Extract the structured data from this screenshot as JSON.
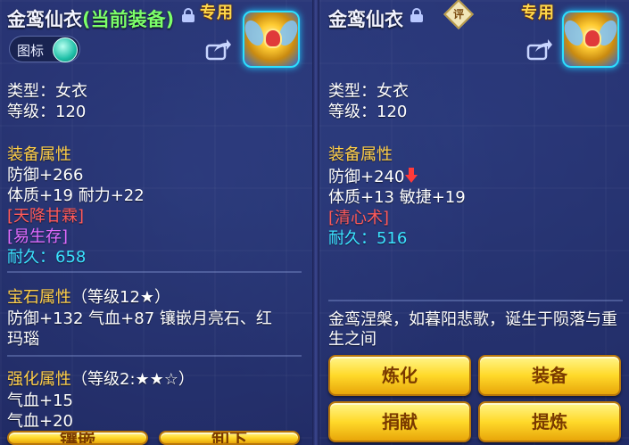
{
  "left": {
    "title": "金鸾仙衣",
    "equip_state": "(当前装备)",
    "exclusive": "专用",
    "icon_toggle_label": "图标",
    "info": [
      "类型：女衣",
      "等级：120"
    ],
    "attr_title": "装备属性",
    "attrs": [
      "防御+266",
      "体质+19 耐力+22"
    ],
    "special_1": "[天降甘霖]",
    "special_2": "[易生存]",
    "durability_label": "耐久：",
    "durability_value": "658",
    "gem_title": "宝石属性",
    "gem_level": "（等级12★）",
    "gem_line_1": "防御+132 气血+87 镶嵌月亮石、红",
    "gem_line_2": "玛瑙",
    "enhance_title": "强化属性",
    "enhance_level": "（等级2:★★☆）",
    "enhance_lines": [
      "气血+15",
      "气血+20"
    ],
    "buttons": [
      "镶嵌",
      "卸下"
    ]
  },
  "right": {
    "title": "金鸾仙衣",
    "rate_badge": "评",
    "exclusive": "专用",
    "info": [
      "类型：女衣",
      "等级：120"
    ],
    "attr_title": "装备属性",
    "attr_defense": "防御+240",
    "attr_line_2": "体质+13 敏捷+19",
    "special_1": "[清心术]",
    "durability_label": "耐久：",
    "durability_value": "516",
    "description": "金鸾涅槃，如暮阳悲歌，诞生于陨落与重生之间",
    "buttons": [
      "炼化",
      "装备",
      "捐献",
      "提炼"
    ]
  },
  "colors": {
    "title": "#f3f4ff",
    "equipped": "#7cff6a",
    "section": "#ffcf4a",
    "special_red": "#ff5a5a",
    "special_purple": "#e06cff",
    "durability": "#3be3ff",
    "button": "#ffd92a"
  },
  "icons": {
    "lock": "lock-icon",
    "share": "share-icon",
    "down_arrow": "down-arrow-icon"
  }
}
